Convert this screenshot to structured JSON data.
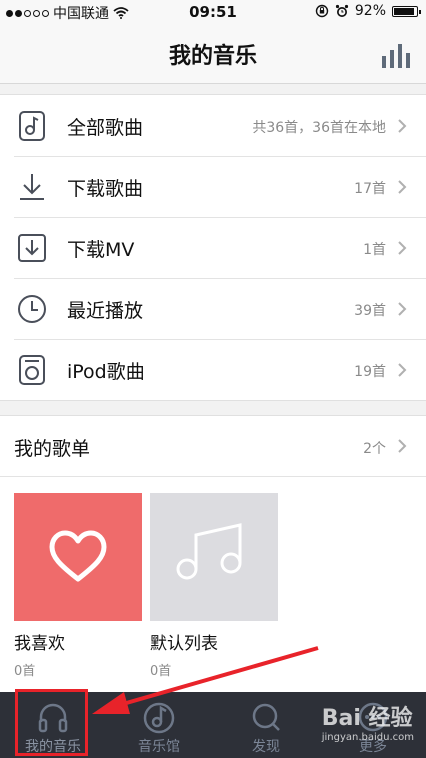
{
  "status_bar": {
    "carrier": "中国联通",
    "time": "09:51",
    "battery": "92%",
    "battery_level": 0.92
  },
  "header": {
    "title": "我的音乐",
    "equalizer_icon": "equalizer-icon"
  },
  "library": [
    {
      "icon": "music-file-icon",
      "label": "全部歌曲",
      "count": "共36首，36首在本地"
    },
    {
      "icon": "download-icon",
      "label": "下载歌曲",
      "count": "17首"
    },
    {
      "icon": "download-mv-icon",
      "label": "下载MV",
      "count": "1首"
    },
    {
      "icon": "clock-icon",
      "label": "最近播放",
      "count": "39首"
    },
    {
      "icon": "ipod-icon",
      "label": "iPod歌曲",
      "count": "19首"
    }
  ],
  "playlists": {
    "title": "我的歌单",
    "count": "2个",
    "items": [
      {
        "name": "我喜欢",
        "count": "0首",
        "color": "#ef6b6b",
        "icon": "heart-icon"
      },
      {
        "name": "默认列表",
        "count": "0首",
        "color": "#dcdce0",
        "icon": "music-note-icon"
      }
    ]
  },
  "tabbar": {
    "tabs": [
      {
        "label": "我的音乐",
        "icon": "headphones-icon",
        "active": true
      },
      {
        "label": "音乐馆",
        "icon": "music-hall-icon",
        "active": false
      },
      {
        "label": "发现",
        "icon": "search-icon",
        "active": false
      },
      {
        "label": "更多",
        "icon": "more-icon",
        "active": false
      }
    ]
  },
  "watermark": {
    "brand": "Bai 经验",
    "url": "jingyan.baidu.com"
  },
  "colors": {
    "accent_red": "#e8232a",
    "tabbar_bg": "#2d3038",
    "icon_gray": "#4a4f5a"
  }
}
